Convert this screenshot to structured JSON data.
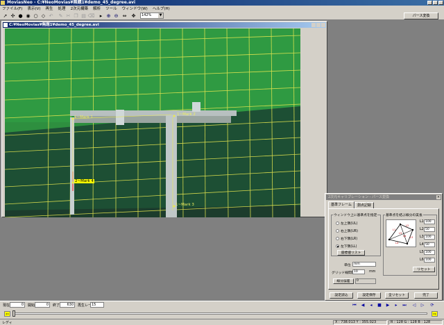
{
  "app": {
    "title": "MoviasNeo - C:¥NeoMovias¥無題1¥demo_45_degree.avi"
  },
  "menu": [
    "ファイル(F)",
    "表示(V)",
    "再生",
    "処理",
    "2次元構築",
    "解析",
    "ツール",
    "ウィンドウ(W)",
    "ヘルプ(H)"
  ],
  "toolbar": {
    "zoom": "142%",
    "parse_button": "パース変換"
  },
  "child_window": {
    "title": "C:¥NeoMovias¥無題1¥demo_45_degree.avi"
  },
  "marks": [
    {
      "label": "1~Mark 1"
    },
    {
      "label": "1~Mark 2"
    },
    {
      "label": "2~Mark 4"
    },
    {
      "label": "1~Mark 3"
    }
  ],
  "dialog": {
    "title": "2次元キャリブレーション - パース変換",
    "tabs": [
      "基準フレーム",
      "測点記録"
    ],
    "window_group": "ウィンドウ上に基準点を指定",
    "radios": [
      {
        "label": "左上隅(UL)",
        "selected": false
      },
      {
        "label": "右上隅(UR)",
        "selected": false
      },
      {
        "label": "右下隅(LR)",
        "selected": false
      },
      {
        "label": "左下隅(LL)",
        "selected": true
      }
    ],
    "coord_list_button": "座標値リスト",
    "length_group": "基準点を結ぶ線分の実長",
    "lengths": [
      {
        "label": "L1",
        "value": "100"
      },
      {
        "label": "L2",
        "value": "50"
      },
      {
        "label": "L3",
        "value": "100"
      },
      {
        "label": "L4",
        "value": "50"
      },
      {
        "label": "L5",
        "value": "100"
      },
      {
        "label": "L6",
        "value": "100"
      }
    ],
    "diagram_labels": [
      "L1",
      "L2",
      "L3",
      "L4",
      "L5",
      "L6"
    ],
    "unit_label": "単位",
    "unit_value": "mm",
    "grid_label": "グリッド線間隔",
    "grid_value": "10",
    "grid_unit": "mm",
    "reset_button": "リセット",
    "error_label": "線分誤差",
    "error_value": "0",
    "buttons": [
      "設定読込",
      "設定保存",
      "全リセット",
      "完了"
    ]
  },
  "playback": {
    "current_label": "現在",
    "current_value": "0",
    "start_label": "開始",
    "start_value": "0",
    "end_label": "終了",
    "end_value": "630",
    "rate_label": "再生レート",
    "rate_value": "15"
  },
  "status": {
    "left": "レディ",
    "coords": "X : 738.013  Y : 355.023",
    "rgb": "R : 128  G : 128  B : 128"
  }
}
